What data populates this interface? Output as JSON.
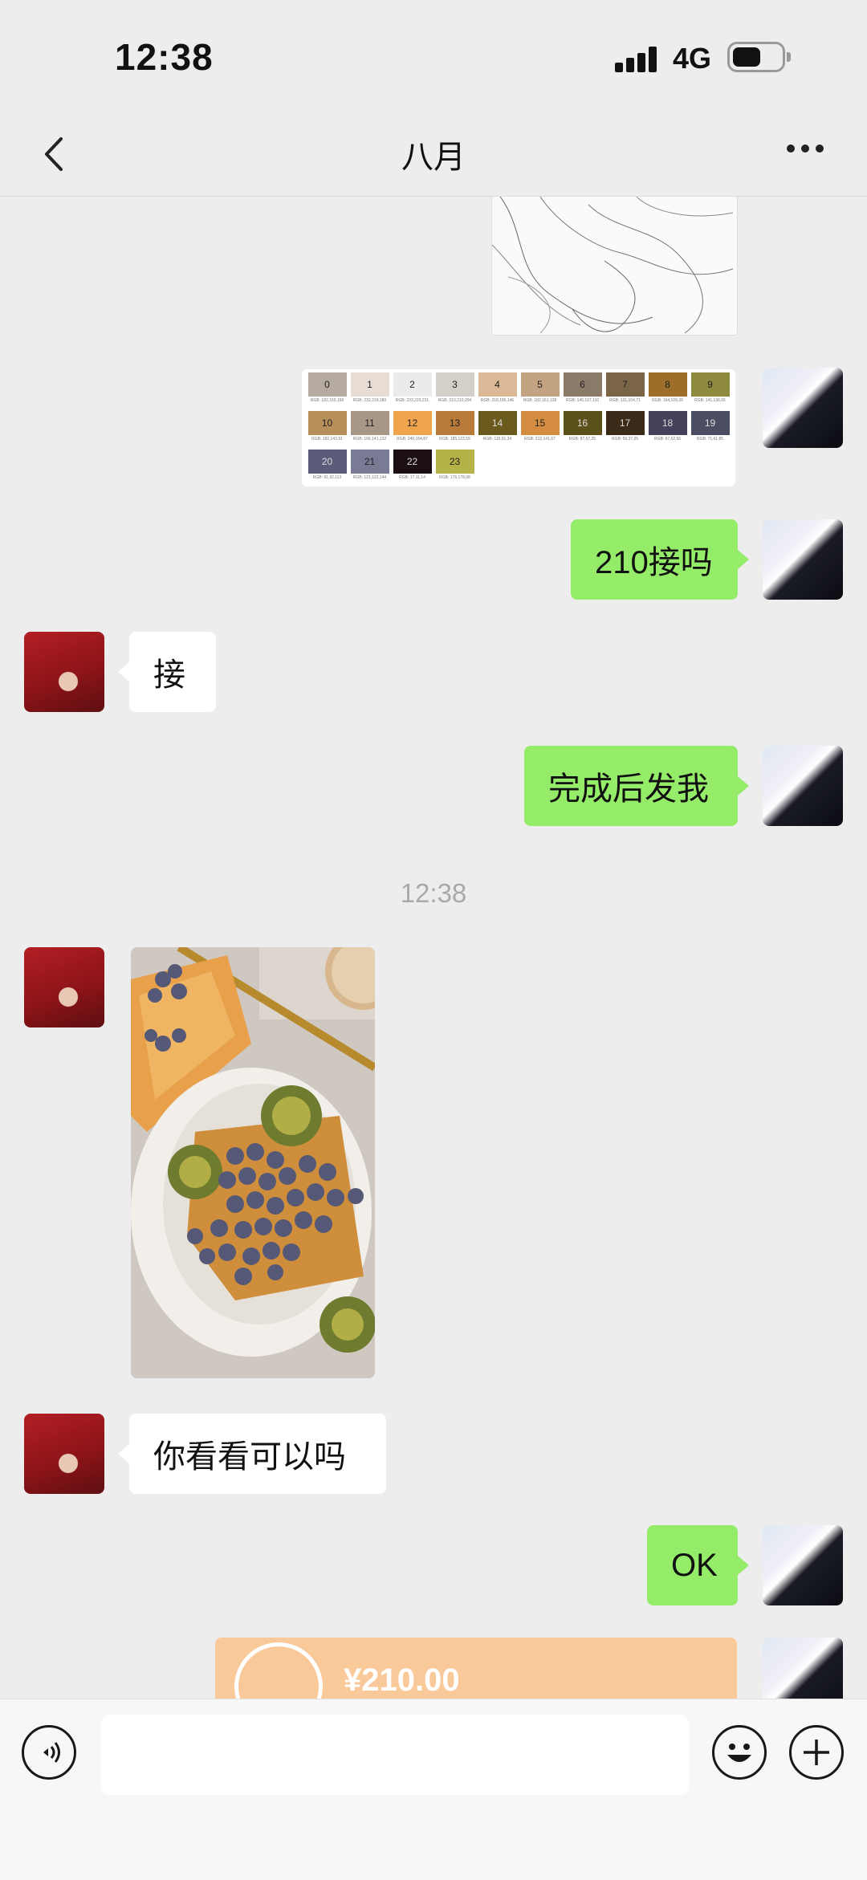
{
  "status_bar": {
    "time": "12:38",
    "network": "4G"
  },
  "header": {
    "title": "八月"
  },
  "palette": [
    {
      "num": "0",
      "color": "#b6aba0",
      "rgb": "RGB: 182,169,158"
    },
    {
      "num": "1",
      "color": "#e8ddd4",
      "rgb": "RGB: 232,219,180"
    },
    {
      "num": "2",
      "color": "#ecebe9",
      "rgb": "RGB: 233,229,231"
    },
    {
      "num": "3",
      "color": "#d2d0c9",
      "rgb": "RGB: 210,210,204"
    },
    {
      "num": "4",
      "color": "#dcb996",
      "rgb": "RGB: 218,186,146"
    },
    {
      "num": "5",
      "color": "#c4a382",
      "rgb": "RGB: 182,161,128"
    },
    {
      "num": "6",
      "color": "#8c7a68",
      "rgb": "RGB: 140,107,110"
    },
    {
      "num": "7",
      "color": "#7a6647",
      "rgb": "RGB: 131,104,71"
    },
    {
      "num": "8",
      "color": "#9c6e2a",
      "rgb": "RGB: 164,109,39"
    },
    {
      "num": "9",
      "color": "#8f8b3e",
      "rgb": "RGB: 141,136,65"
    },
    {
      "num": "10",
      "color": "#b68f5b",
      "rgb": "RGB: 182,143,91"
    },
    {
      "num": "11",
      "color": "#a89686",
      "rgb": "RGB: 166,141,132"
    },
    {
      "num": "12",
      "color": "#f0a54d",
      "rgb": "RGB: 240,164,87"
    },
    {
      "num": "13",
      "color": "#b97a3a",
      "rgb": "RGB: 185,123,59"
    },
    {
      "num": "14",
      "color": "#6b5a1e",
      "rgb": "RGB: 115,91,34"
    },
    {
      "num": "15",
      "color": "#d48c40",
      "rgb": "RGB: 212,141,67"
    },
    {
      "num": "16",
      "color": "#5b4f1a",
      "rgb": "RGB: 87,67,25"
    },
    {
      "num": "17",
      "color": "#3b2a18",
      "rgb": "RGB: 59,37,25"
    },
    {
      "num": "18",
      "color": "#43425a",
      "rgb": "RGB: 67,62,56"
    },
    {
      "num": "19",
      "color": "#4b4d62",
      "rgb": "RGB: 71,61,85"
    },
    {
      "num": "20",
      "color": "#5b5c7a",
      "rgb": "RGB: 91,92,113"
    },
    {
      "num": "21",
      "color": "#797a94",
      "rgb": "RGB: 121,122,144"
    },
    {
      "num": "22",
      "color": "#1b0f14",
      "rgb": "RGB: 17,11,14"
    },
    {
      "num": "23",
      "color": "#b5b247",
      "rgb": "RGB: 176,178,68"
    }
  ],
  "messages": {
    "m1": "210接吗",
    "m2": "接",
    "m3": "完成后发我",
    "m4": "你看看可以吗",
    "m5": "OK"
  },
  "timestamp": "12:38",
  "transfer": {
    "amount": "¥210.00"
  },
  "icons": {
    "back": "chevron-left-icon",
    "more": "more-dots-icon",
    "voice": "voice-icon",
    "emoji": "emoji-icon",
    "plus": "plus-icon"
  }
}
